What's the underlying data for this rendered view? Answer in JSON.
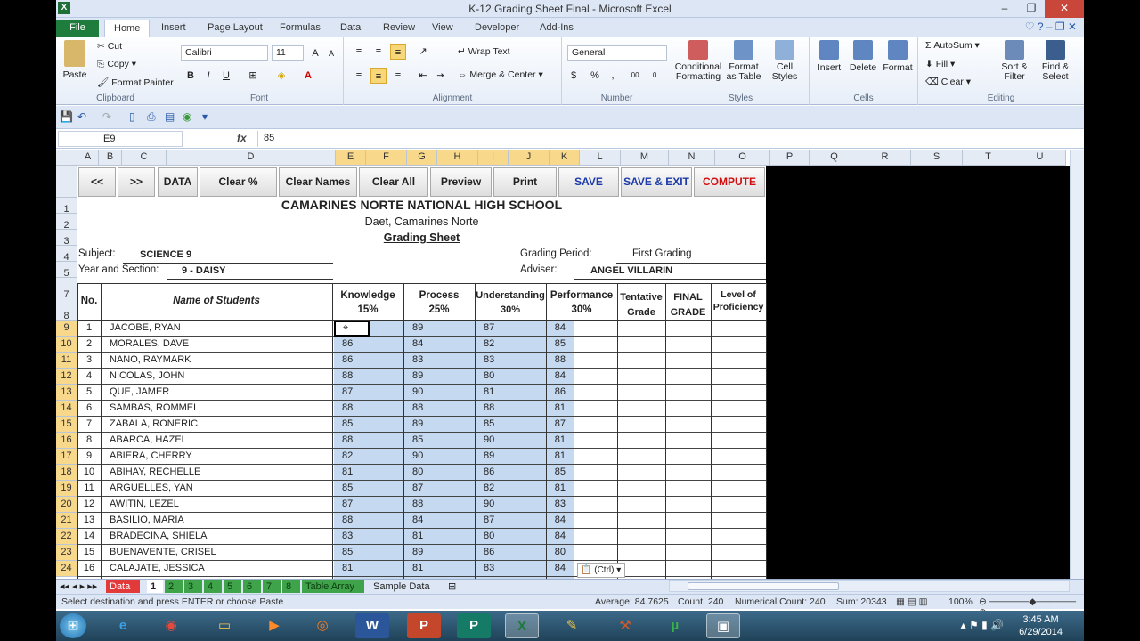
{
  "window": {
    "title": "K-12 Grading Sheet Final  -  Microsoft Excel"
  },
  "ribbon": {
    "tabs": [
      "File",
      "Home",
      "Insert",
      "Page Layout",
      "Formulas",
      "Data",
      "Review",
      "View",
      "Developer",
      "Add-Ins"
    ],
    "clipboard": {
      "paste": "Paste",
      "cut": "Cut",
      "copy": "Copy",
      "format_painter": "Format Painter",
      "label": "Clipboard"
    },
    "font": {
      "name": "Calibri",
      "size": "11",
      "label": "Font",
      "bold": "B",
      "italic": "I",
      "underline": "U"
    },
    "alignment": {
      "wrap": "Wrap Text",
      "merge": "Merge & Center",
      "label": "Alignment"
    },
    "number": {
      "format": "General",
      "label": "Number",
      "currency": "$",
      "percent": "%",
      "comma": ","
    },
    "styles": {
      "conditional": "Conditional Formatting",
      "as_table": "Format as Table",
      "cell_styles": "Cell Styles",
      "label": "Styles"
    },
    "cells": {
      "insert": "Insert",
      "delete": "Delete",
      "format": "Format",
      "label": "Cells"
    },
    "editing": {
      "autosum": "AutoSum",
      "fill": "Fill",
      "clear": "Clear",
      "sort": "Sort & Filter",
      "find": "Find & Select",
      "label": "Editing"
    }
  },
  "formula_bar": {
    "name_box": "E9",
    "fx": "fx",
    "value": "85"
  },
  "columns": [
    "A",
    "B",
    "C",
    "D",
    "E",
    "F",
    "G",
    "H",
    "I",
    "J",
    "K",
    "L",
    "M",
    "N",
    "O",
    "P",
    "Q",
    "R",
    "S",
    "T",
    "U"
  ],
  "macro_buttons": [
    "<<",
    ">>",
    "DATA",
    "Clear %",
    "Clear Names",
    "Clear All",
    "Preview",
    "Print",
    "SAVE",
    "SAVE & EXIT",
    "COMPUTE"
  ],
  "header": {
    "school": "CAMARINES NORTE NATIONAL HIGH SCHOOL",
    "address": "Daet, Camarines Norte",
    "sheet_title": "Grading Sheet",
    "subject_label": "Subject:",
    "subject": "SCIENCE 9",
    "section_label": "Year and Section:",
    "section": "9 - DAISY",
    "period_label": "Grading Period:",
    "period": "First Grading",
    "adviser_label": "Adviser:",
    "adviser": "ANGEL VILLARIN"
  },
  "table_headers": {
    "no": "No.",
    "name": "Name of Students",
    "knowledge": "Knowledge",
    "knowledge_pct": "15%",
    "process": "Process",
    "process_pct": "25%",
    "understanding": "Understanding",
    "understanding_pct": "30%",
    "performance": "Performance",
    "performance_pct": "30%",
    "tentative": "Tentative Grade",
    "final": "FINAL GRADE",
    "proficiency": "Level of Proficiency"
  },
  "students": [
    {
      "row": "9",
      "no": "1",
      "name": "JACOBE, RYAN",
      "k": "",
      "p": "89",
      "u": "87",
      "perf": "84"
    },
    {
      "row": "10",
      "no": "2",
      "name": "MORALES, DAVE",
      "k": "86",
      "p": "84",
      "u": "82",
      "perf": "85"
    },
    {
      "row": "11",
      "no": "3",
      "name": "NANO, RAYMARK",
      "k": "86",
      "p": "83",
      "u": "83",
      "perf": "88"
    },
    {
      "row": "12",
      "no": "4",
      "name": "NICOLAS, JOHN",
      "k": "88",
      "p": "89",
      "u": "80",
      "perf": "84"
    },
    {
      "row": "13",
      "no": "5",
      "name": "QUE, JAMER",
      "k": "87",
      "p": "90",
      "u": "81",
      "perf": "86"
    },
    {
      "row": "14",
      "no": "6",
      "name": "SAMBAS, ROMMEL",
      "k": "88",
      "p": "88",
      "u": "88",
      "perf": "81"
    },
    {
      "row": "15",
      "no": "7",
      "name": "ZABALA, RONERIC",
      "k": "85",
      "p": "89",
      "u": "85",
      "perf": "87"
    },
    {
      "row": "16",
      "no": "8",
      "name": "ABARCA, HAZEL",
      "k": "88",
      "p": "85",
      "u": "90",
      "perf": "81"
    },
    {
      "row": "17",
      "no": "9",
      "name": "ABIERA, CHERRY",
      "k": "82",
      "p": "90",
      "u": "89",
      "perf": "81"
    },
    {
      "row": "18",
      "no": "10",
      "name": "ABIHAY, RECHELLE",
      "k": "81",
      "p": "80",
      "u": "86",
      "perf": "85"
    },
    {
      "row": "19",
      "no": "11",
      "name": "ARGUELLES, YAN",
      "k": "85",
      "p": "87",
      "u": "82",
      "perf": "81"
    },
    {
      "row": "20",
      "no": "12",
      "name": "AWITIN, LEZEL",
      "k": "87",
      "p": "88",
      "u": "90",
      "perf": "83"
    },
    {
      "row": "21",
      "no": "13",
      "name": "BASILIO, MARIA",
      "k": "88",
      "p": "84",
      "u": "87",
      "perf": "84"
    },
    {
      "row": "22",
      "no": "14",
      "name": "BRADECINA, SHIELA",
      "k": "83",
      "p": "81",
      "u": "80",
      "perf": "84"
    },
    {
      "row": "23",
      "no": "15",
      "name": "BUENAVENTE, CRISEL",
      "k": "85",
      "p": "89",
      "u": "86",
      "perf": "80"
    },
    {
      "row": "24",
      "no": "16",
      "name": "CALAJATE, JESSICA",
      "k": "81",
      "p": "81",
      "u": "83",
      "perf": "84"
    }
  ],
  "header_rows": [
    "",
    "1",
    "2",
    "3",
    "4",
    "5",
    "7",
    "8"
  ],
  "paste_popup": "(Ctrl)",
  "sheet_tabs": [
    "Data",
    "1",
    "2",
    "3",
    "4",
    "5",
    "6",
    "7",
    "8",
    "Table Array",
    "Sample Data"
  ],
  "status": {
    "message": "Select destination and press ENTER or choose Paste",
    "average": "Average: 84.7625",
    "count": "Count: 240",
    "numerical_count": "Numerical Count: 240",
    "sum": "Sum: 20343",
    "zoom": "100%"
  },
  "taskbar": {
    "time": "3:45 AM",
    "date": "6/29/2014"
  },
  "colors": {
    "selection": "#c5d9f1",
    "file_tab": "#1e7d3c",
    "compute": "#d01010",
    "save": "#1d3aa8"
  }
}
